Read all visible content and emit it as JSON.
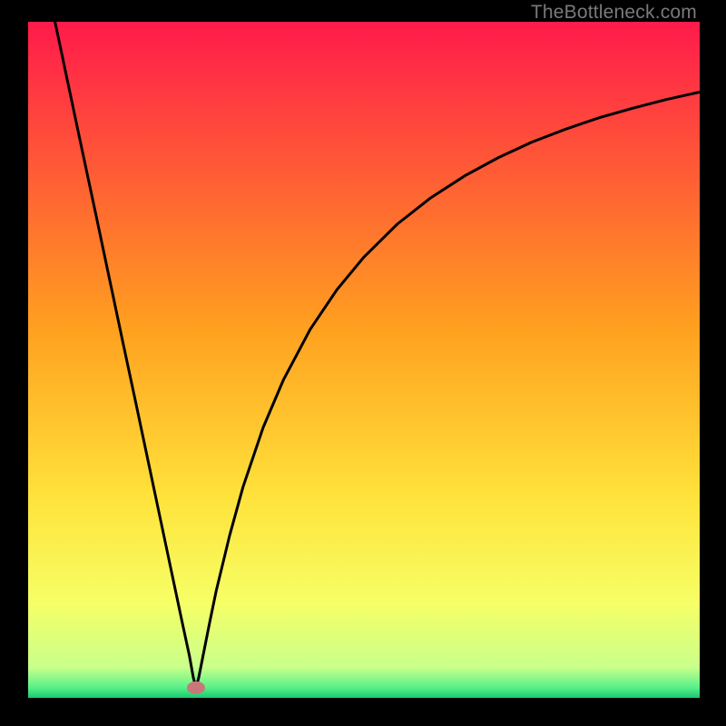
{
  "watermark": "TheBottleneck.com",
  "chart_data": {
    "type": "line",
    "title": "",
    "xlabel": "",
    "ylabel": "",
    "xlim": [
      0,
      100
    ],
    "ylim": [
      0,
      100
    ],
    "grid": false,
    "legend": false,
    "background_gradient": {
      "stops": [
        {
          "pos": 0.0,
          "color": "#ff1a4b"
        },
        {
          "pos": 0.45,
          "color": "#ff9f1f"
        },
        {
          "pos": 0.7,
          "color": "#ffe23a"
        },
        {
          "pos": 0.86,
          "color": "#f6ff66"
        },
        {
          "pos": 0.955,
          "color": "#c9ff8a"
        },
        {
          "pos": 0.985,
          "color": "#57f08a"
        },
        {
          "pos": 1.0,
          "color": "#18c96f"
        }
      ]
    },
    "marker": {
      "x": 25.0,
      "y": 1.5,
      "color": "#c87878"
    },
    "series": [
      {
        "name": "curve",
        "color": "#000000",
        "x": [
          4.0,
          6,
          8,
          10,
          12,
          14,
          16,
          18,
          20,
          22,
          23,
          24,
          24.6,
          25.0,
          25.4,
          26,
          27,
          28,
          30,
          32,
          35,
          38,
          42,
          46,
          50,
          55,
          60,
          65,
          70,
          75,
          80,
          85,
          90,
          95,
          100
        ],
        "y": [
          100,
          90.6,
          81.2,
          71.9,
          62.5,
          53.1,
          43.8,
          34.4,
          25.0,
          15.6,
          10.9,
          6.3,
          3.0,
          1.5,
          3.0,
          6.0,
          11.0,
          15.8,
          24.0,
          31.2,
          40.0,
          47.0,
          54.5,
          60.4,
          65.2,
          70.1,
          74.0,
          77.2,
          79.9,
          82.2,
          84.1,
          85.8,
          87.2,
          88.5,
          89.6
        ]
      }
    ]
  }
}
